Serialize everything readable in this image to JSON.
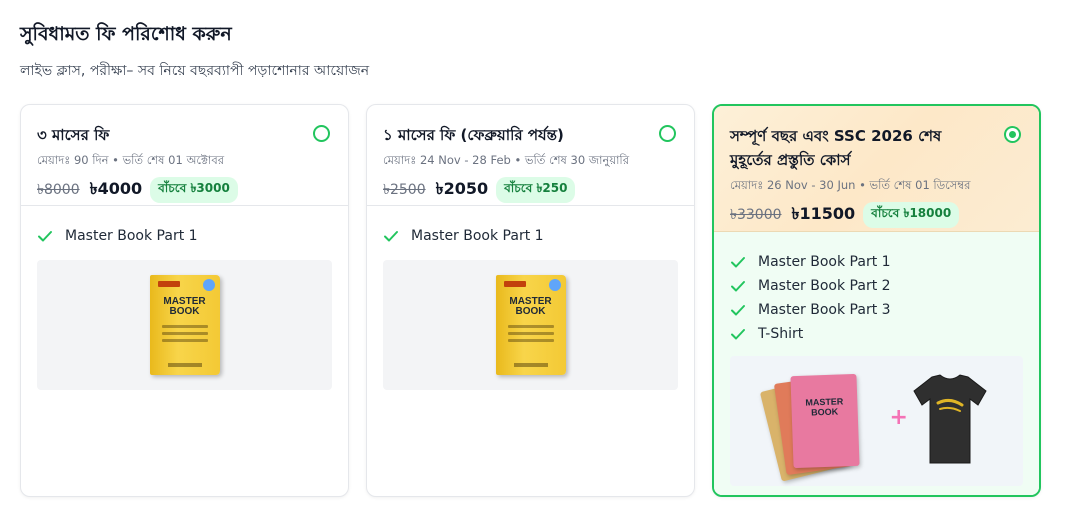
{
  "header": {
    "title": "সুবিধামত ফি পরিশোধ করুন",
    "subtitle": "লাইভ ক্লাস, পরীক্ষা– সব নিয়ে বছরব্যাপী পড়াশোনার আয়োজন"
  },
  "plans": [
    {
      "name": "৩ মাসের ফি",
      "meta": "মেয়াদঃ 90 দিন • ভর্তি শেষ 01 অক্টোবর",
      "old_price": "৳8000",
      "new_price": "৳4000",
      "save": "বাঁচবে ৳3000",
      "selected": false,
      "features": [
        "Master Book Part 1"
      ],
      "image": "master-book-yellow"
    },
    {
      "name": "১ মাসের ফি (ফেব্রুয়ারি পর্যন্ত)",
      "meta": "মেয়াদঃ 24 Nov - 28 Feb • ভর্তি শেষ 30 জানুয়ারি",
      "old_price": "৳2500",
      "new_price": "৳2050",
      "save": "বাঁচবে ৳250",
      "selected": false,
      "features": [
        "Master Book Part 1"
      ],
      "image": "master-book-yellow"
    },
    {
      "name": "সম্পূর্ণ বছর এবং SSC 2026 শেষ মুহূর্তের প্রস্তুতি কোর্স",
      "meta": "মেয়াদঃ 26 Nov - 30 Jun • ভর্তি শেষ 01 ডিসেম্বর",
      "old_price": "৳33000",
      "new_price": "৳11500",
      "save": "বাঁচবে ৳18000",
      "selected": true,
      "features": [
        "Master Book Part 1",
        "Master Book Part 2",
        "Master Book Part 3",
        "T-Shirt"
      ],
      "image": "master-book-stack-plus-tshirt"
    }
  ],
  "book_cover": {
    "title_line1": "MASTER",
    "title_line2": "BOOK"
  },
  "colors": {
    "accent": "#22c55e",
    "badge_bg": "#dcfce7",
    "badge_text": "#15803d",
    "selected_header_bg": "#fde8c8",
    "selected_body_bg": "#f0fdf4"
  },
  "icons": {
    "feature": "check-icon",
    "selector": "radio-icon"
  }
}
